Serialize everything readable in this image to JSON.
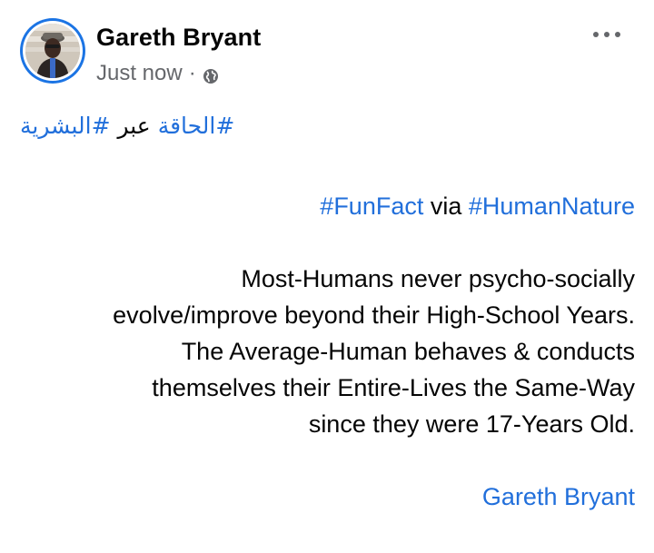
{
  "post": {
    "author_name": "Gareth Bryant",
    "timestamp": "Just now",
    "separator": "·",
    "audience_icon": "globe-icon",
    "more_icon": "more-options-icon",
    "arabic_line": {
      "tag1": "#الحاقة",
      "word": "عبر",
      "tag2": "#البشرية"
    },
    "headline": {
      "tag1": "#FunFact",
      "word": "via",
      "tag2": "#HumanNature"
    },
    "paragraph_lines": [
      "Most-Humans never psycho-socially",
      "evolve/improve beyond their High-School Years.",
      "The Average-Human behaves & conducts",
      "themselves their Entire-Lives the Same-Way",
      "since they were 17-Years Old."
    ],
    "signature": "Gareth Bryant"
  },
  "colors": {
    "link": "#216fdb",
    "text": "#050505",
    "secondary": "#65676b",
    "avatar_ring": "#1b74e4"
  }
}
